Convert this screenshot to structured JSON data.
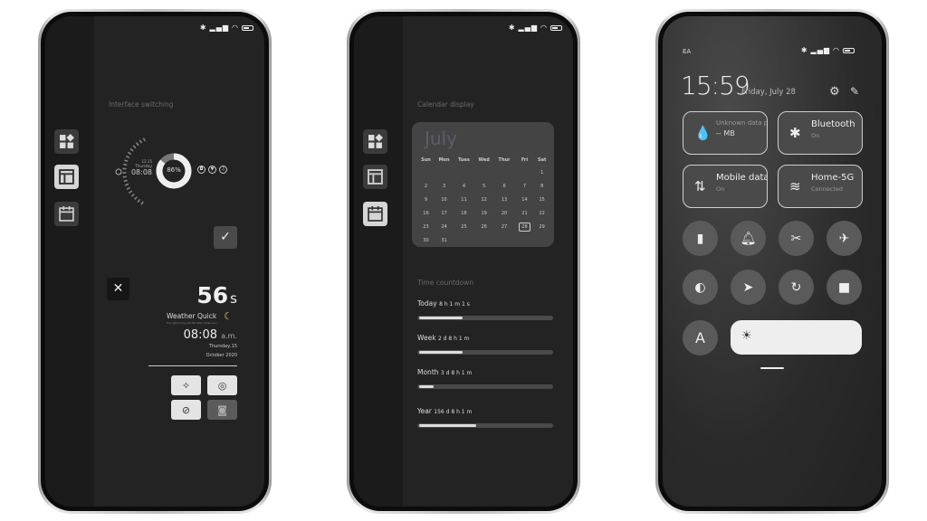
{
  "phone1": {
    "section_title": "Interface switching",
    "widget": {
      "date": "12.15",
      "weekday": "Thursday",
      "time": "08:08",
      "battery_percent": "86%",
      "battery_fraction": 0.86
    },
    "seconds_value": "56",
    "seconds_unit": "s",
    "weather_title": "Weather Quick",
    "weather_sub": "The night is long, and the dawn comes soon",
    "clock": "08:08",
    "clock_suffix": "a.m.",
    "date_line1": "Thursday,15",
    "date_line2": "October 2020"
  },
  "phone2": {
    "calendar_title": "Calendar display",
    "month": "July",
    "weekdays": [
      "Sun",
      "Mon",
      "Tues",
      "Wed",
      "Thur",
      "Fri",
      "Sat"
    ],
    "weeks": [
      [
        "",
        "",
        "",
        "",
        "",
        "",
        "1"
      ],
      [
        "2",
        "3",
        "4",
        "5",
        "6",
        "7",
        "8"
      ],
      [
        "9",
        "10",
        "11",
        "12",
        "13",
        "14",
        "15"
      ],
      [
        "16",
        "17",
        "18",
        "19",
        "20",
        "21",
        "22"
      ],
      [
        "23",
        "24",
        "25",
        "26",
        "27",
        "28",
        "29"
      ],
      [
        "30",
        "31",
        "",
        "",
        "",
        "",
        ""
      ]
    ],
    "selected_day": "28",
    "countdown_title": "Time countdown",
    "countdowns": [
      {
        "label": "Today",
        "value": "8 h 1 m 1 s",
        "progress": 0.33
      },
      {
        "label": "Week",
        "value": "2 d 8 h 1 m",
        "progress": 0.33
      },
      {
        "label": "Month",
        "value": "3 d 8 h 1 m",
        "progress": 0.11
      },
      {
        "label": "Year",
        "value": "156 d 8 h 1 m",
        "progress": 0.43
      }
    ]
  },
  "phone3": {
    "carrier": "EA",
    "time": "15:59",
    "date": "Friday, July 28",
    "tiles": [
      {
        "name": "Unknown data plan",
        "status": "-- MB"
      },
      {
        "name": "Bluetooth",
        "status": "On"
      },
      {
        "name": "Mobile data",
        "status": "On"
      },
      {
        "name": "Home-5G",
        "status": "Connected"
      }
    ],
    "auto_brightness_label": "A"
  }
}
